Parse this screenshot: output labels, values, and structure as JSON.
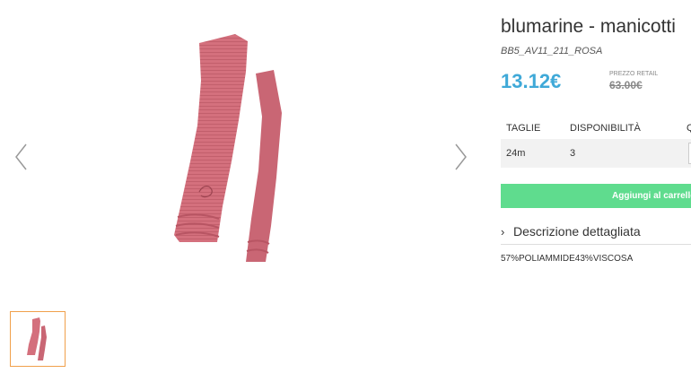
{
  "product": {
    "title": "blumarine - manicotti",
    "sku": "BB5_AV11_211_ROSA",
    "price": "13.12€",
    "retail_label": "PREZZO RETAIL",
    "retail_price": "63.00€"
  },
  "sizes": {
    "headers": [
      "TAGLIE",
      "DISPONIBILITÀ",
      "Q"
    ],
    "rows": [
      {
        "size": "24m",
        "availability": "3",
        "quantity": ""
      }
    ]
  },
  "actions": {
    "add_to_cart": "Aggiungi al carrello"
  },
  "description": {
    "toggle_label": "Descrizione dettagliata",
    "text": "57%POLIAMMIDE43%VISCOSA"
  },
  "gallery": {
    "main_image": "pink-knit-sleeves",
    "thumbnail": "pink-knit-sleeves"
  },
  "colors": {
    "price": "#3fa9d8",
    "cart_button": "#5fdc8e",
    "thumb_border": "#f0a04b",
    "product": "#d96f7c"
  }
}
